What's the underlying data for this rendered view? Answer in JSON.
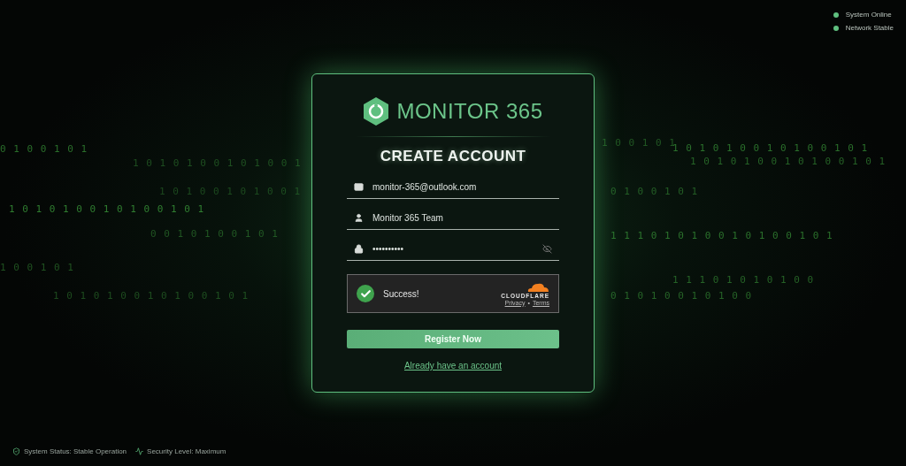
{
  "status_indicators": [
    {
      "label": "System Online",
      "color": "#5fbf7f"
    },
    {
      "label": "Network Stable",
      "color": "#5fbf7f"
    }
  ],
  "binary_rows": [
    "0 1 0 0 1 0 1",
    "1 0 1 0 1 0 0 1 0 1 0 0 1",
    "1 0 1 0 0 1 0 1 0 0 1",
    "1 0 1 0 1 0 0 1 0 1 0 0 1 0 1",
    "0 0 1 0 1 0 0 1 0 1",
    "1 0 0 1 0 1",
    "1 0 1 0 1 0 0 1 0 1 0 0 1 0 1",
    "1 0 0 1 0 1",
    "1 0 1 0 1 0 0 1 0 1 0 0 1 0 1",
    "1 0 1 0 1 0 0 1 0 1 0 0 1 0 1",
    "0 1 0 0 1 0 1",
    "1 1 1 0 1 0 1 0 0 1 0 1 0 0 1 0 1",
    "1 1 1 0 1 0 1 0 1 0 0",
    "0 1 0 1 0 0 1 0 1 0 0"
  ],
  "card": {
    "brand": "MONITOR 365",
    "title": "CREATE ACCOUNT",
    "fields": [
      {
        "kind": "email",
        "value": "monitor-365@outlook.com"
      },
      {
        "kind": "name",
        "value": "Monitor 365 Team"
      },
      {
        "kind": "password",
        "value": "••••••••••"
      }
    ],
    "captcha": {
      "checked": true,
      "message": "Success!",
      "provider": "CLOUDFLARE",
      "links": [
        "Privacy",
        "Terms"
      ],
      "separator": "•"
    },
    "submit": "Register Now",
    "login_link": "Already have an account"
  },
  "footer": [
    {
      "kind": "status",
      "label": "System Status: Stable Operation"
    },
    {
      "kind": "security",
      "label": "Security Level: Maximum"
    }
  ]
}
